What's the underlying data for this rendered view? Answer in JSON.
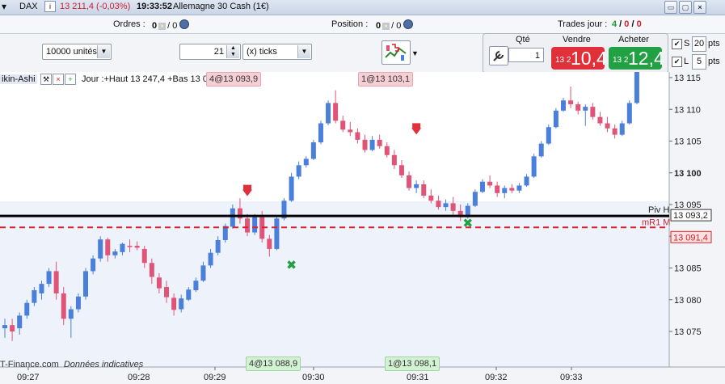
{
  "titlebar": {
    "symbol": "DAX",
    "price": "13 211,4 (-0,03%)",
    "time": "19:33:52",
    "instrument": "Allemagne 30 Cash (1€)",
    "btn_min": "▭",
    "btn_max": "▢"
  },
  "orders_bar": {
    "orders_label": "Ordres :",
    "orders_v1": "0",
    "orders_v2": "/ 0",
    "position_label": "Position :",
    "position_v1": "0",
    "position_v2": "/ 0",
    "trades_label": "Trades jour :",
    "trades_v1": "4",
    "trades_v2": "0",
    "trades_v3": "0"
  },
  "toolbar": {
    "units_value": "10000 unités",
    "ticks_value": "21",
    "ticks_unit": "(x) ticks"
  },
  "trade_panel": {
    "qty_label": "Qté",
    "qty_value": "1",
    "sell_label": "Vendre",
    "buy_label": "Acheter",
    "sell_small": "13 2",
    "sell_big": "10,4",
    "buy_small": "13 2",
    "buy_big": "12,4",
    "s_label": "S",
    "s_value": "20",
    "l_label": "L",
    "l_value": "5",
    "unit": "pts",
    "colors": {
      "sell": "#e0303a",
      "buy": "#22a044"
    }
  },
  "chart": {
    "legend_name": "ikin-Ashi",
    "legend_info": "Jour :+Haut 13 247,4 +Bas 13 03",
    "watermark": "T-Finance.com",
    "watermark_note": "Données indicatives",
    "top_tags": [
      "4@13 093,9",
      "1@13 103,1"
    ],
    "bottom_tags": [
      "4@13 088,9",
      "1@13 098,1"
    ],
    "pivot_label": "Piv H",
    "pivot_value": "13 093,2",
    "mr1_label": "mR1 M",
    "mr1_value": "13 091,4"
  },
  "chart_data": {
    "type": "candlestick",
    "y_ticks": [
      "13 115",
      "13 110",
      "13 105",
      "13 100",
      "13 095",
      "13 090",
      "13 085",
      "13 080",
      "13 075"
    ],
    "x_ticks": [
      "09:27",
      "09:28",
      "09:29",
      "09:30",
      "09:31",
      "09:32",
      "09:33"
    ],
    "ylim": [
      13072,
      13116
    ],
    "pivot_level": 13093.2,
    "mr1_level": 13091.4,
    "colors": {
      "up": "#4a7fdc",
      "down": "#e05478",
      "pivot": "#000000",
      "mr1": "#e0202a"
    },
    "candles": [
      [
        13075.5,
        13077,
        13074,
        13076
      ],
      [
        13076,
        13077,
        13073.5,
        13075
      ],
      [
        13075.5,
        13078,
        13074.5,
        13077.5
      ],
      [
        13077.5,
        13080,
        13077,
        13079.5
      ],
      [
        13079.5,
        13082,
        13079,
        13081.5
      ],
      [
        13081,
        13083,
        13080,
        13082.5
      ],
      [
        13082.5,
        13085,
        13082,
        13084.5
      ],
      [
        13084.5,
        13086,
        13080,
        13081
      ],
      [
        13081,
        13082,
        13076,
        13077
      ],
      [
        13077,
        13079,
        13074,
        13078.5
      ],
      [
        13078.5,
        13081,
        13078,
        13080.5
      ],
      [
        13080.5,
        13085,
        13080,
        13084.5
      ],
      [
        13084.5,
        13087,
        13084,
        13086.5
      ],
      [
        13086.5,
        13090,
        13086,
        13089.5
      ],
      [
        13089.5,
        13089.8,
        13086,
        13087
      ],
      [
        13087,
        13088,
        13086.5,
        13087.6
      ],
      [
        13087.5,
        13089,
        13087,
        13088.8
      ],
      [
        13088.5,
        13089.5,
        13087.5,
        13088.4
      ],
      [
        13088.5,
        13089.2,
        13087.8,
        13088.2
      ],
      [
        13088,
        13088.5,
        13085,
        13085.8
      ],
      [
        13085.8,
        13086.5,
        13082.5,
        13083.6
      ],
      [
        13083.5,
        13084.2,
        13081,
        13081.8
      ],
      [
        13082,
        13083,
        13079.5,
        13080.4
      ],
      [
        13080.3,
        13081,
        13077.5,
        13078.4
      ],
      [
        13078.5,
        13080.8,
        13078,
        13080.2
      ],
      [
        13080,
        13082,
        13079.8,
        13081.6
      ],
      [
        13081.5,
        13083.5,
        13081.2,
        13083
      ],
      [
        13083,
        13086,
        13082.8,
        13085.4
      ],
      [
        13085.4,
        13088,
        13085,
        13087.4
      ],
      [
        13087.4,
        13090,
        13087,
        13089.4
      ],
      [
        13089.4,
        13092,
        13089,
        13091.6
      ],
      [
        13091.5,
        13095,
        13091.2,
        13094.4
      ],
      [
        13094.4,
        13096,
        13092,
        13092.8
      ],
      [
        13092.8,
        13093.5,
        13090,
        13090.6
      ],
      [
        13090.6,
        13093.5,
        13090.2,
        13093
      ],
      [
        13093,
        13094,
        13089,
        13089.6
      ],
      [
        13089.6,
        13090.2,
        13086.8,
        13088
      ],
      [
        13088,
        13093,
        13087.8,
        13092.8
      ],
      [
        13092.8,
        13096,
        13092.5,
        13095.6
      ],
      [
        13095.6,
        13100,
        13095.4,
        13099.4
      ],
      [
        13099.4,
        13101.8,
        13099,
        13101.2
      ],
      [
        13101.2,
        13102.6,
        13100.8,
        13102.2
      ],
      [
        13102.2,
        13105.2,
        13102,
        13104.8
      ],
      [
        13104.8,
        13108.2,
        13104.5,
        13107.8
      ],
      [
        13107.8,
        13111.4,
        13107.5,
        13111
      ],
      [
        13111,
        13113,
        13107.8,
        13108.2
      ],
      [
        13108.2,
        13109,
        13106.4,
        13106.8
      ],
      [
        13106.8,
        13108,
        13105.8,
        13106.4
      ],
      [
        13106.4,
        13107,
        13104.6,
        13105.2
      ],
      [
        13105.2,
        13106,
        13103.2,
        13103.6
      ],
      [
        13103.6,
        13105.8,
        13103.4,
        13105.2
      ],
      [
        13105.2,
        13106,
        13103.8,
        13104.2
      ],
      [
        13104.2,
        13104.8,
        13102.4,
        13102.8
      ],
      [
        13102.8,
        13103.6,
        13100.6,
        13101.2
      ],
      [
        13101.2,
        13102,
        13099.2,
        13099.6
      ],
      [
        13099.6,
        13100.2,
        13097.2,
        13097.6
      ],
      [
        13097.6,
        13098.8,
        13096.8,
        13098.2
      ],
      [
        13098.2,
        13098.8,
        13096,
        13096.4
      ],
      [
        13096.4,
        13097.4,
        13095.2,
        13095.6
      ],
      [
        13095.6,
        13096.4,
        13094.2,
        13094.6
      ],
      [
        13094.6,
        13095.8,
        13094,
        13095.2
      ],
      [
        13095.2,
        13096.2,
        13093.4,
        13094
      ],
      [
        13094,
        13095,
        13092.4,
        13093
      ],
      [
        13093,
        13095.2,
        13092.8,
        13094.8
      ],
      [
        13094.8,
        13097.4,
        13094.6,
        13097
      ],
      [
        13097,
        13099,
        13096.8,
        13098.6
      ],
      [
        13098.6,
        13099.6,
        13097.6,
        13098
      ],
      [
        13098,
        13098.6,
        13096.2,
        13096.8
      ],
      [
        13096.8,
        13098,
        13096,
        13097.6
      ],
      [
        13097.6,
        13098.2,
        13096.8,
        13097.2
      ],
      [
        13097.2,
        13098.4,
        13096.8,
        13098
      ],
      [
        13098,
        13099.8,
        13097.8,
        13099.4
      ],
      [
        13099.4,
        13103,
        13099.2,
        13102.6
      ],
      [
        13102.6,
        13105,
        13102.4,
        13104.6
      ],
      [
        13104.6,
        13107.6,
        13104.4,
        13107.2
      ],
      [
        13107.2,
        13110.2,
        13107,
        13109.8
      ],
      [
        13109.8,
        13111.8,
        13109.6,
        13111.4
      ],
      [
        13111.4,
        13113.6,
        13110.2,
        13110.8
      ],
      [
        13110.8,
        13111.2,
        13109.2,
        13109.8
      ],
      [
        13109.8,
        13110.8,
        13107.4,
        13110.4
      ],
      [
        13110.4,
        13111,
        13108.4,
        13108.8
      ],
      [
        13108.8,
        13109.6,
        13107.4,
        13107.8
      ],
      [
        13107.8,
        13108.8,
        13106.4,
        13107
      ],
      [
        13107,
        13107.6,
        13105.4,
        13106
      ],
      [
        13106,
        13108.2,
        13105.8,
        13107.8
      ],
      [
        13107.8,
        13111.4,
        13107.6,
        13111
      ],
      [
        13111,
        13117,
        13110.8,
        13116.6
      ],
      [
        13116.6,
        13119,
        13116.4,
        13118.6
      ]
    ],
    "markers": [
      {
        "type": "sell",
        "index": 33,
        "price": 13094.8
      },
      {
        "type": "sell",
        "index": 56,
        "price": 13104.5
      },
      {
        "type": "buy",
        "index": 39,
        "price": 13086.8
      },
      {
        "type": "buy",
        "index": 63,
        "price": 13093.4
      }
    ]
  }
}
